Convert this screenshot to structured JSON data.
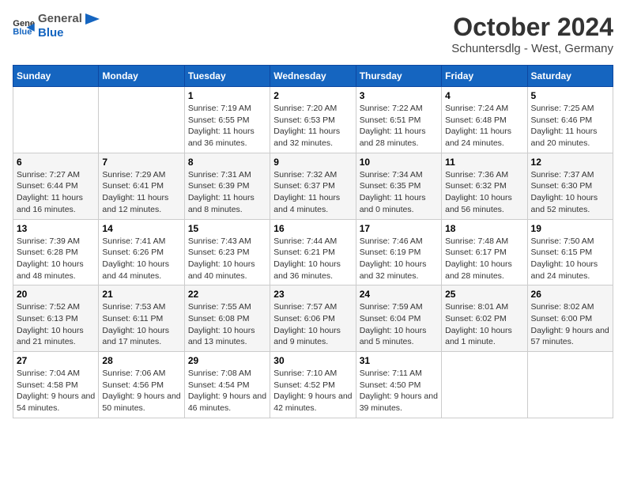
{
  "header": {
    "logo_general": "General",
    "logo_blue": "Blue",
    "month_title": "October 2024",
    "subtitle": "Schuntersdlg - West, Germany"
  },
  "days_of_week": [
    "Sunday",
    "Monday",
    "Tuesday",
    "Wednesday",
    "Thursday",
    "Friday",
    "Saturday"
  ],
  "weeks": [
    [
      {
        "day": "",
        "detail": ""
      },
      {
        "day": "",
        "detail": ""
      },
      {
        "day": "1",
        "detail": "Sunrise: 7:19 AM\nSunset: 6:55 PM\nDaylight: 11 hours and 36 minutes."
      },
      {
        "day": "2",
        "detail": "Sunrise: 7:20 AM\nSunset: 6:53 PM\nDaylight: 11 hours and 32 minutes."
      },
      {
        "day": "3",
        "detail": "Sunrise: 7:22 AM\nSunset: 6:51 PM\nDaylight: 11 hours and 28 minutes."
      },
      {
        "day": "4",
        "detail": "Sunrise: 7:24 AM\nSunset: 6:48 PM\nDaylight: 11 hours and 24 minutes."
      },
      {
        "day": "5",
        "detail": "Sunrise: 7:25 AM\nSunset: 6:46 PM\nDaylight: 11 hours and 20 minutes."
      }
    ],
    [
      {
        "day": "6",
        "detail": "Sunrise: 7:27 AM\nSunset: 6:44 PM\nDaylight: 11 hours and 16 minutes."
      },
      {
        "day": "7",
        "detail": "Sunrise: 7:29 AM\nSunset: 6:41 PM\nDaylight: 11 hours and 12 minutes."
      },
      {
        "day": "8",
        "detail": "Sunrise: 7:31 AM\nSunset: 6:39 PM\nDaylight: 11 hours and 8 minutes."
      },
      {
        "day": "9",
        "detail": "Sunrise: 7:32 AM\nSunset: 6:37 PM\nDaylight: 11 hours and 4 minutes."
      },
      {
        "day": "10",
        "detail": "Sunrise: 7:34 AM\nSunset: 6:35 PM\nDaylight: 11 hours and 0 minutes."
      },
      {
        "day": "11",
        "detail": "Sunrise: 7:36 AM\nSunset: 6:32 PM\nDaylight: 10 hours and 56 minutes."
      },
      {
        "day": "12",
        "detail": "Sunrise: 7:37 AM\nSunset: 6:30 PM\nDaylight: 10 hours and 52 minutes."
      }
    ],
    [
      {
        "day": "13",
        "detail": "Sunrise: 7:39 AM\nSunset: 6:28 PM\nDaylight: 10 hours and 48 minutes."
      },
      {
        "day": "14",
        "detail": "Sunrise: 7:41 AM\nSunset: 6:26 PM\nDaylight: 10 hours and 44 minutes."
      },
      {
        "day": "15",
        "detail": "Sunrise: 7:43 AM\nSunset: 6:23 PM\nDaylight: 10 hours and 40 minutes."
      },
      {
        "day": "16",
        "detail": "Sunrise: 7:44 AM\nSunset: 6:21 PM\nDaylight: 10 hours and 36 minutes."
      },
      {
        "day": "17",
        "detail": "Sunrise: 7:46 AM\nSunset: 6:19 PM\nDaylight: 10 hours and 32 minutes."
      },
      {
        "day": "18",
        "detail": "Sunrise: 7:48 AM\nSunset: 6:17 PM\nDaylight: 10 hours and 28 minutes."
      },
      {
        "day": "19",
        "detail": "Sunrise: 7:50 AM\nSunset: 6:15 PM\nDaylight: 10 hours and 24 minutes."
      }
    ],
    [
      {
        "day": "20",
        "detail": "Sunrise: 7:52 AM\nSunset: 6:13 PM\nDaylight: 10 hours and 21 minutes."
      },
      {
        "day": "21",
        "detail": "Sunrise: 7:53 AM\nSunset: 6:11 PM\nDaylight: 10 hours and 17 minutes."
      },
      {
        "day": "22",
        "detail": "Sunrise: 7:55 AM\nSunset: 6:08 PM\nDaylight: 10 hours and 13 minutes."
      },
      {
        "day": "23",
        "detail": "Sunrise: 7:57 AM\nSunset: 6:06 PM\nDaylight: 10 hours and 9 minutes."
      },
      {
        "day": "24",
        "detail": "Sunrise: 7:59 AM\nSunset: 6:04 PM\nDaylight: 10 hours and 5 minutes."
      },
      {
        "day": "25",
        "detail": "Sunrise: 8:01 AM\nSunset: 6:02 PM\nDaylight: 10 hours and 1 minute."
      },
      {
        "day": "26",
        "detail": "Sunrise: 8:02 AM\nSunset: 6:00 PM\nDaylight: 9 hours and 57 minutes."
      }
    ],
    [
      {
        "day": "27",
        "detail": "Sunrise: 7:04 AM\nSunset: 4:58 PM\nDaylight: 9 hours and 54 minutes."
      },
      {
        "day": "28",
        "detail": "Sunrise: 7:06 AM\nSunset: 4:56 PM\nDaylight: 9 hours and 50 minutes."
      },
      {
        "day": "29",
        "detail": "Sunrise: 7:08 AM\nSunset: 4:54 PM\nDaylight: 9 hours and 46 minutes."
      },
      {
        "day": "30",
        "detail": "Sunrise: 7:10 AM\nSunset: 4:52 PM\nDaylight: 9 hours and 42 minutes."
      },
      {
        "day": "31",
        "detail": "Sunrise: 7:11 AM\nSunset: 4:50 PM\nDaylight: 9 hours and 39 minutes."
      },
      {
        "day": "",
        "detail": ""
      },
      {
        "day": "",
        "detail": ""
      }
    ]
  ]
}
